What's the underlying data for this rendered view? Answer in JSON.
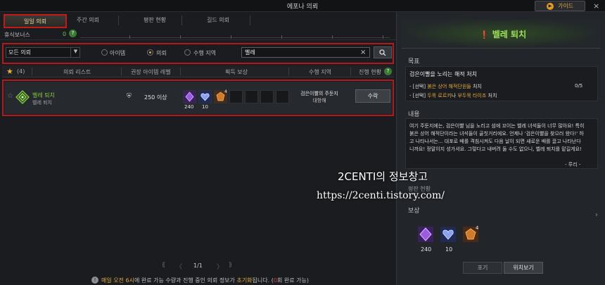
{
  "window": {
    "title": "에포나 의뢰",
    "guide_label": "가이드",
    "close": "×"
  },
  "tabs": [
    "일일 의뢰",
    "주간 의뢰",
    "평판 현황",
    "길드 의뢰"
  ],
  "rest_bonus": {
    "label": "휴식보너스",
    "value": "0",
    "help": "?"
  },
  "filter": {
    "select_value": "모든 의뢰",
    "radios": [
      {
        "label": "아이템",
        "selected": false
      },
      {
        "label": "의뢰",
        "selected": true
      },
      {
        "label": "수행 지역",
        "selected": false
      }
    ],
    "search_value": "벨레",
    "clear": "×"
  },
  "table": {
    "fav_count": "(4)",
    "headers": [
      "의뢰 리스트",
      "권장 아이템 레벨",
      "획득 보상",
      "수행 지역",
      "진행 현황"
    ],
    "help": "?"
  },
  "row": {
    "name": "벨레 퇴치",
    "sub": "벨레 퇴치",
    "level": "250 이상",
    "reward_counts": [
      "240",
      "10",
      "4"
    ],
    "region_line1": "검은이빨의 주둔지",
    "region_line2": "대항해",
    "accept_label": "수락"
  },
  "pager": {
    "page": "1/1",
    "first": "⟪",
    "prev": "〈",
    "next": "〉",
    "last": "⟫"
  },
  "footer": {
    "part1": "매일 오전 6시",
    "part2": "에 완료 가능 수량과 진행 중인 의뢰 정보가 ",
    "part3": "초기화",
    "part4": "됩니다. (",
    "part5": "0",
    "part6": "회 완료 가능)",
    "icon": "!"
  },
  "detail": {
    "title": "벨레 퇴치",
    "goal_heading": "목표",
    "goal_main": "검은이빨을 노리는 해적 처치",
    "goals": [
      {
        "prefix": "- [선택] ",
        "highlight": "붉은 상어 해적단원들",
        "suffix": " 처치",
        "count": "0/5"
      },
      {
        "prefix": "- [선택] ",
        "highlight": "두목 로르키",
        "mid": "나 ",
        "highlight2": "부두목 타이조",
        "suffix": " 처치"
      }
    ],
    "desc_heading": "내용",
    "desc": "여기 주둔지에는, 검은이빨 님을 노리고 섬에 꼬이는 벨레 녀석들이 너무 많아요! 특히 붉은 상어 해적단이라는 녀석들이 골칫거리에요. 언제나 '검은이빨을 찾으러 왔다!' 하고 나타나서는... 대포로 배를 격침시켜도 다음 날이 되면 새로운 배를 끌고 나타난다니까요! 정말이지 성가셔요. 그렇다고 내버려 둘 수도 없으니, 벨레 퇴치를 맡길게요!",
    "sign": "- 루리 -",
    "reputation_heading": "평판 현황",
    "reward_heading": "보상",
    "reward_counts": [
      "240",
      "10",
      "4"
    ],
    "abandon_label": "포기",
    "locate_label": "위치보기"
  },
  "watermark": {
    "line1": "2CENTI의 정보창고",
    "line2": "https://2centi.tistory.com/"
  },
  "colors": {
    "accent_red": "#b5191c",
    "quest_green": "#84c63b",
    "highlight_orange": "#e2a942"
  }
}
